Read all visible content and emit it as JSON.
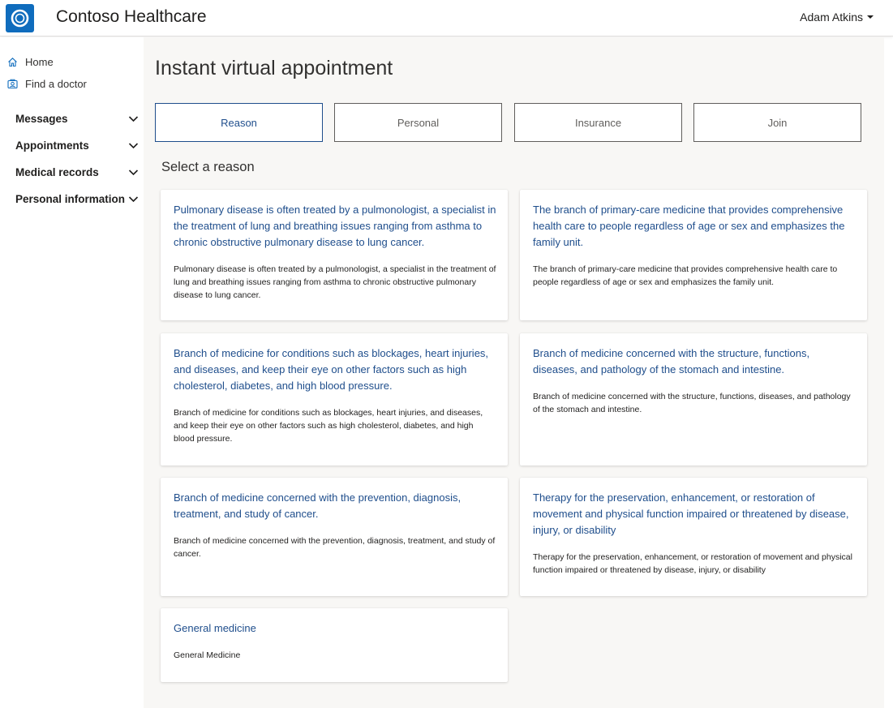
{
  "header": {
    "app_title": "Contoso Healthcare",
    "user_name": "Adam Atkins",
    "logo_icon": "contoso-ring-logo",
    "accent_color": "#0f6cbd"
  },
  "sidebar": {
    "links": [
      {
        "label": "Home",
        "icon": "home-icon"
      },
      {
        "label": "Find a doctor",
        "icon": "doctor-icon"
      }
    ],
    "groups": [
      {
        "label": "Messages"
      },
      {
        "label": "Appointments"
      },
      {
        "label": "Medical records"
      },
      {
        "label": "Personal information"
      }
    ]
  },
  "main": {
    "page_title": "Instant virtual appointment",
    "steps": [
      {
        "label": "Reason",
        "active": true
      },
      {
        "label": "Personal",
        "active": false
      },
      {
        "label": "Insurance",
        "active": false
      },
      {
        "label": "Join",
        "active": false
      }
    ],
    "section_title": "Select a reason",
    "reasons": [
      {
        "title": "Pulmonary disease is often treated by a pulmonologist, a specialist in the treatment of lung and breathing issues ranging from asthma to chronic obstructive pulmonary disease to lung cancer.",
        "description": "Pulmonary disease is often treated by a pulmonologist, a specialist in the treatment of lung and breathing issues ranging from asthma to chronic obstructive pulmonary disease to lung cancer."
      },
      {
        "title": "The branch of primary-care medicine that provides comprehensive health care to people regardless of age or sex and emphasizes the family unit.",
        "description": "The branch of primary-care medicine that provides comprehensive health care to people regardless of age or sex and emphasizes the family unit."
      },
      {
        "title": "Branch of medicine for conditions such as blockages, heart injuries, and diseases, and keep their eye on other factors such as high cholesterol, diabetes, and high blood pressure.",
        "description": "Branch of medicine for conditions such as blockages, heart injuries, and diseases, and keep their eye on other factors such as high cholesterol, diabetes, and high blood pressure."
      },
      {
        "title": "Branch of medicine concerned with the structure, functions, diseases, and pathology of the stomach and intestine.",
        "description": "Branch of medicine concerned with the structure, functions, diseases, and pathology of the stomach and intestine."
      },
      {
        "title": "Branch of medicine concerned with the prevention, diagnosis, treatment, and study of cancer.",
        "description": "Branch of medicine concerned with the prevention, diagnosis, treatment, and study of cancer."
      },
      {
        "title": "Therapy for the preservation, enhancement, or restoration of movement and physical function impaired or threatened by disease, injury, or disability",
        "description": "Therapy for the preservation, enhancement, or restoration of movement and physical function impaired or threatened by disease, injury, or disability"
      },
      {
        "title": "General medicine",
        "description": "General Medicine"
      }
    ]
  }
}
